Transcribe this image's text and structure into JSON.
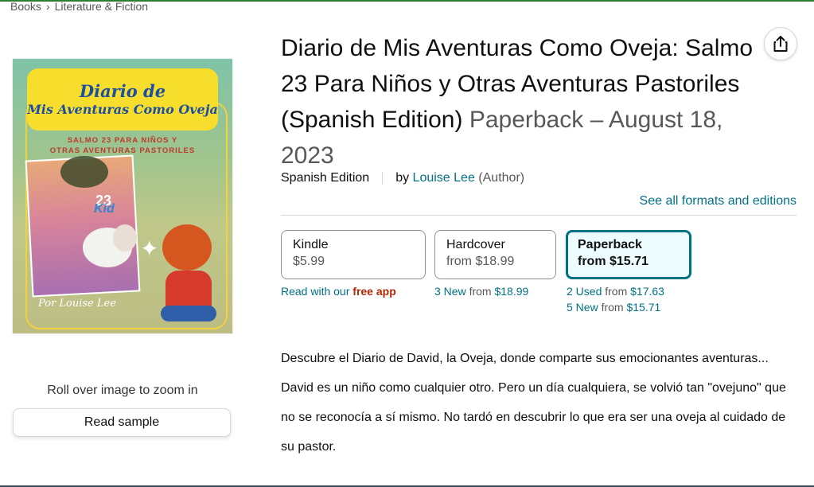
{
  "breadcrumb": [
    "Books",
    "Literature & Fiction"
  ],
  "product": {
    "title": "Diario de Mis Aventuras Como Oveja: Salmo 23 Para Niños y Otras Aventuras Pastoriles (Spanish Edition)",
    "format_date": "Paperback – August 18, 2023",
    "edition": "Spanish Edition",
    "by": "by",
    "author": "Louise Lee",
    "author_role": "(Author)",
    "see_all": "See all formats and editions"
  },
  "cover": {
    "title_line1": "Diario de",
    "title_line2": "Mis Aventuras Como Oveja",
    "subtitle_line1": "SALMO 23 PARA NIÑOS Y",
    "subtitle_line2": "OTRAS AVENTURAS PASTORILES",
    "inner_ps": "23",
    "inner_kid": "Kid",
    "author": "Por Louise Lee",
    "zoom_hint": "Roll over image to zoom in",
    "read_sample": "Read sample"
  },
  "formats": [
    {
      "name": "Kindle",
      "price": "$5.99",
      "selected": false
    },
    {
      "name": "Hardcover",
      "price": "from $18.99",
      "selected": false
    },
    {
      "name": "Paperback",
      "price": "from $15.71",
      "selected": true
    }
  ],
  "format_notes": {
    "kindle_prefix": "Read with our",
    "kindle_free_app": "free app",
    "hardcover_new_count": "3 New",
    "hardcover_new_from": "from",
    "hardcover_new_price": "$18.99",
    "paperback_used_count": "2 Used",
    "paperback_used_from": "from",
    "paperback_used_price": "$17.63",
    "paperback_new_count": "5 New",
    "paperback_new_from": "from",
    "paperback_new_price": "$15.71"
  },
  "description": [
    "Descubre el Diario de David, la Oveja, donde comparte sus emocionantes aventuras...",
    "David es un niño como cualquier otro. Pero un día cualquiera, se volvió tan \"ovejuno\" que no se reconocía a sí mismo. No tardó en descubrir lo que era ser una oveja al cuidado de su pastor."
  ],
  "icons": {
    "share": "share-icon"
  },
  "colors": {
    "link": "#007185",
    "free_app": "#b12704",
    "selected_border": "#007185",
    "selected_bg": "#edfdff"
  }
}
